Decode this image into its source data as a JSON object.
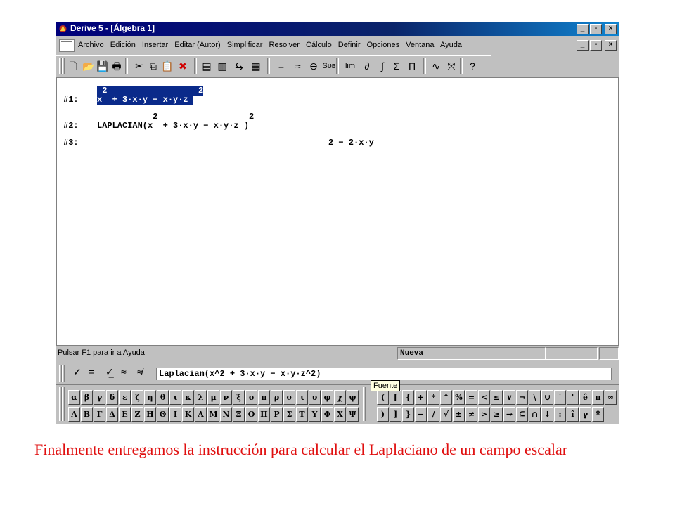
{
  "window": {
    "title": "Derive 5 - [Álgebra 1]",
    "app_icon": "derive-logo-icon",
    "controls": [
      "_",
      "▫",
      "×"
    ]
  },
  "menu": {
    "items": [
      "Archivo",
      "Edición",
      "Insertar",
      "Editar (Autor)",
      "Simplificar",
      "Resolver",
      "Cálculo",
      "Definir",
      "Opciones",
      "Ventana",
      "Ayuda"
    ]
  },
  "toolbar": {
    "buttons": [
      {
        "name": "new-icon",
        "glyph": "🗋"
      },
      {
        "name": "open-icon",
        "glyph": "📂"
      },
      {
        "name": "save-icon",
        "glyph": "💾"
      },
      {
        "name": "print-icon",
        "glyph": "🖶"
      },
      {
        "name": "cut-icon",
        "glyph": "✂"
      },
      {
        "name": "copy-icon",
        "glyph": "⧉"
      },
      {
        "name": "paste-icon",
        "glyph": "📋"
      },
      {
        "name": "delete-icon",
        "glyph": "✖"
      },
      {
        "name": "insert-text-icon",
        "glyph": "▤"
      },
      {
        "name": "insert-note-icon",
        "glyph": "▥"
      },
      {
        "name": "renumber-icon",
        "glyph": "⇆"
      },
      {
        "name": "matrix-icon",
        "glyph": "▦"
      },
      {
        "name": "simplify-icon",
        "glyph": "="
      },
      {
        "name": "approximate-icon",
        "glyph": "≈"
      },
      {
        "name": "solve-icon",
        "glyph": "⊖"
      },
      {
        "name": "substitute-icon",
        "glyph": "Sᴜʙ"
      },
      {
        "name": "limit-icon",
        "glyph": "lim"
      },
      {
        "name": "derivative-icon",
        "glyph": "∂"
      },
      {
        "name": "integral-icon",
        "glyph": "∫"
      },
      {
        "name": "sum-icon",
        "glyph": "Σ"
      },
      {
        "name": "product-icon",
        "glyph": "Π"
      },
      {
        "name": "plot-2d-icon",
        "glyph": "∿"
      },
      {
        "name": "plot-3d-icon",
        "glyph": "⤧"
      },
      {
        "name": "help-icon",
        "glyph": "?"
      }
    ]
  },
  "algebra": {
    "expressions": [
      {
        "label": "#1:",
        "text": "x  + 3·x·y − x·y·z ",
        "sup": " 2                  2",
        "selected": true
      },
      {
        "label": "#2:",
        "text": "LAPLACIAN(x  + 3·x·y − x·y·z )",
        "sup": "           2                  2",
        "selected": false
      },
      {
        "label": "#3:",
        "text": "2 − 2·x·y",
        "sup": "",
        "selected": false
      }
    ]
  },
  "status": {
    "message": "Pulsar F1 para ir a Ayuda",
    "mode": "Nueva"
  },
  "entry": {
    "symbols": [
      {
        "name": "check-icon",
        "glyph": "✓"
      },
      {
        "name": "equals-icon",
        "glyph": "="
      },
      {
        "name": "check-underlined-icon",
        "glyph": "✓̲"
      },
      {
        "name": "approx-icon",
        "glyph": "≈"
      },
      {
        "name": "approx-check-icon",
        "glyph": "≉"
      }
    ],
    "value": "Laplacian(x^2 + 3·x·y − x·y·z^2)"
  },
  "tooltip": "Fuente",
  "palette": {
    "greek_row1": [
      "α",
      "β",
      "γ",
      "δ",
      "ε",
      "ζ",
      "η",
      "θ",
      "ι",
      "κ",
      "λ",
      "μ",
      "ν",
      "ξ",
      "ο",
      "π",
      "ρ",
      "σ",
      "τ",
      "υ",
      "φ",
      "χ",
      "ψ"
    ],
    "greek_row2": [
      "Α",
      "Β",
      "Γ",
      "Δ",
      "Ε",
      "Ζ",
      "Η",
      "Θ",
      "Ι",
      "Κ",
      "Λ",
      "Μ",
      "Ν",
      "Ξ",
      "Ο",
      "Π",
      "Ρ",
      "Σ",
      "Τ",
      "Υ",
      "Φ",
      "Χ",
      "Ψ"
    ],
    "math_row1": [
      "(",
      "[",
      "{",
      "+",
      "*",
      "^",
      "%",
      "=",
      "<",
      "≤",
      "∨",
      "¬",
      "\\",
      "∪",
      "`",
      "'",
      "ê",
      "π",
      "∞"
    ],
    "math_row2": [
      ")",
      "]",
      "}",
      "−",
      "/",
      "√",
      "±",
      "≠",
      ">",
      "≥",
      "→",
      "⊆",
      "∩",
      "↓",
      ":",
      "î",
      "γ",
      "º"
    ]
  },
  "caption": "Finalmente entregamos la instrucción para calcular el Laplaciano de un campo escalar"
}
